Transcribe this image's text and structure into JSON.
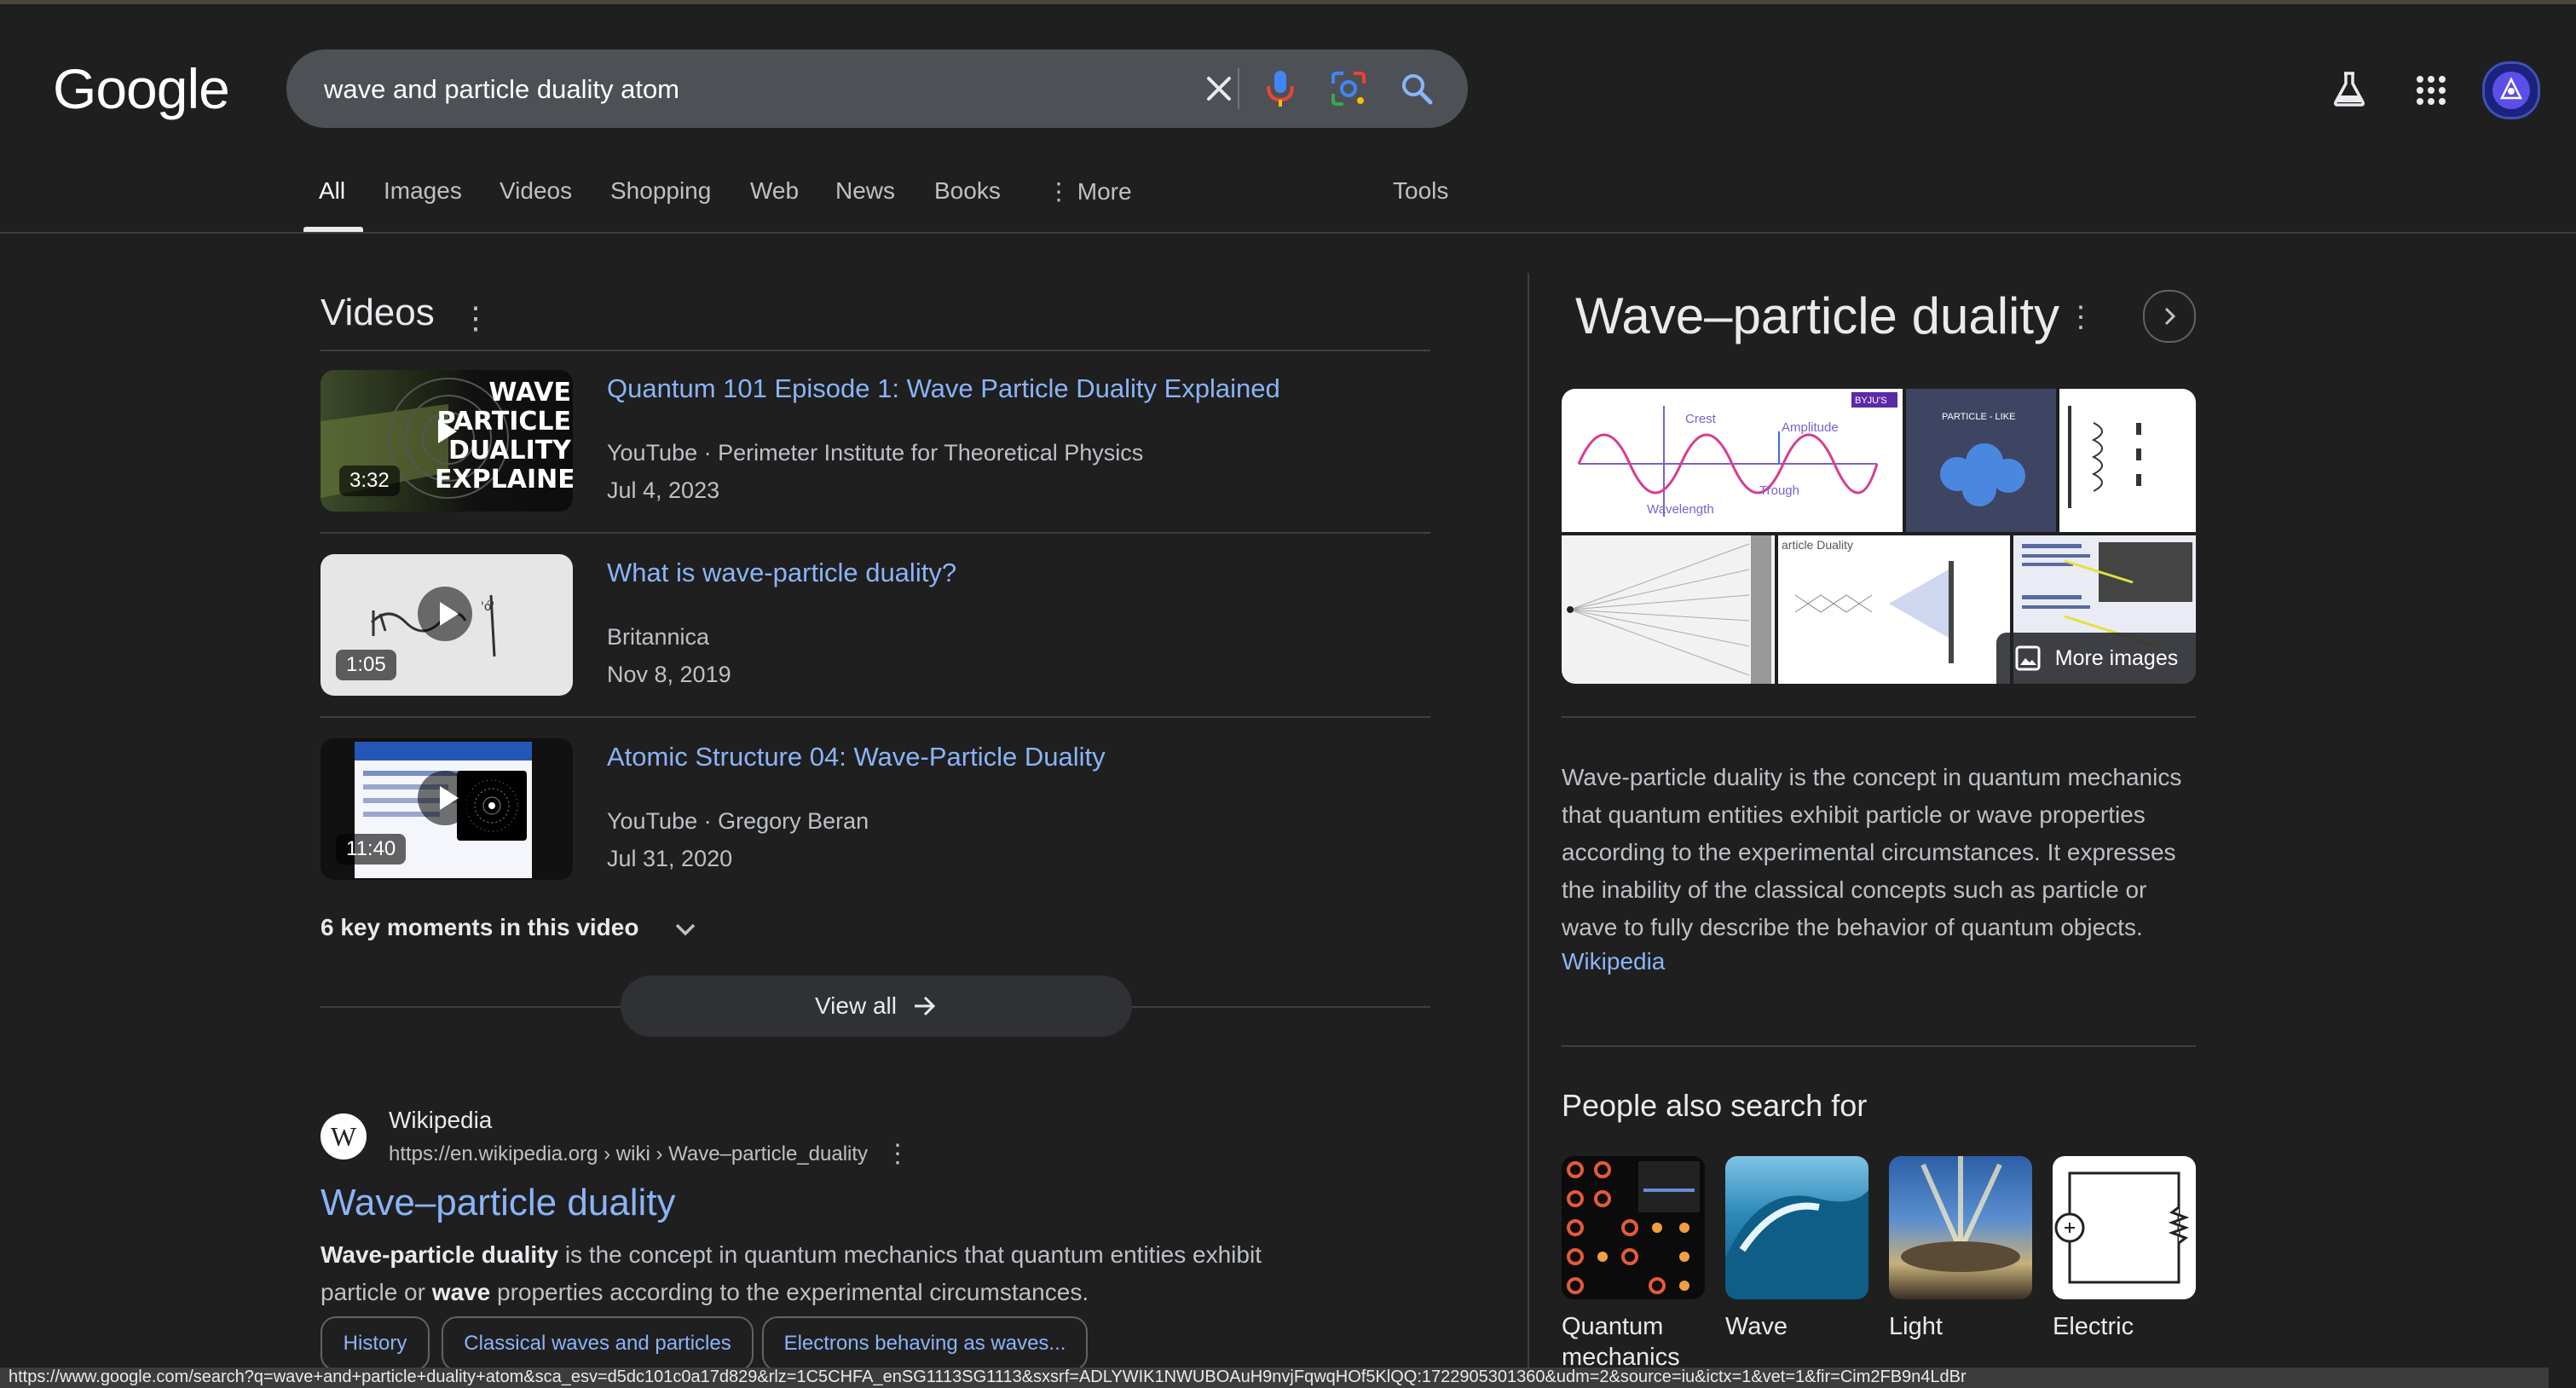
{
  "header": {
    "logo": "Google",
    "search_value": "wave and particle duality atom",
    "icons": [
      "clear-icon",
      "microphone-icon",
      "lens-icon",
      "search-icon",
      "labs-flask-icon",
      "apps-grid-icon",
      "avatar"
    ]
  },
  "tabs": [
    "All",
    "Images",
    "Videos",
    "Shopping",
    "Web",
    "News",
    "Books",
    "More",
    "Tools"
  ],
  "videos": {
    "title": "Videos",
    "items": [
      {
        "title": "Quantum 101 Episode 1: Wave Particle Duality Explained",
        "source": "YouTube · Perimeter Institute for Theoretical Physics",
        "date": "Jul 4, 2023",
        "duration": "3:32",
        "thumb_text": [
          "WAVE",
          "PARTICLE",
          "DUALITY",
          "EXPLAINED"
        ]
      },
      {
        "title": "What is wave-particle duality?",
        "source": "Britannica",
        "date": "Nov 8, 2019",
        "duration": "1:05"
      },
      {
        "title": "Atomic Structure 04: Wave-Particle Duality",
        "source": "YouTube · Gregory Beran",
        "date": "Jul 31, 2020",
        "duration": "11:40"
      }
    ],
    "key_moments": "6 key moments in this video",
    "view_all": "View all"
  },
  "result": {
    "site_name": "Wikipedia",
    "favicon_letter": "W",
    "url": "https://en.wikipedia.org › wiki › Wave–particle_duality",
    "title": "Wave–particle duality",
    "snippet_b1": "Wave-particle duality",
    "snippet_t1": " is the concept in quantum mechanics that quantum entities exhibit",
    "snippet_t2": "particle or ",
    "snippet_b2": "wave",
    "snippet_t3": " properties according to the experimental circumstances.",
    "chips": [
      "History",
      "Classical waves and particles",
      "Electrons behaving as waves..."
    ]
  },
  "knowledge_panel": {
    "title": "Wave–particle duality",
    "more_images": "More images",
    "img_labels": {
      "crest": "Crest",
      "amplitude": "Amplitude",
      "trough": "Trough",
      "wavelength": "Wavelength",
      "particle_like": "PARTICLE - LIKE",
      "byjus": "BYJU'S",
      "particle_duality": "article Duality"
    },
    "description": "Wave-particle duality is the concept in quantum mechanics that quantum entities exhibit particle or wave properties according to the experimental circumstances. It expresses the inability of the classical concepts such as particle or wave to fully describe the behavior of quantum objects.",
    "source_link": "Wikipedia",
    "people_also_search": {
      "title": "People also search for",
      "items": [
        {
          "label1": "Quantum",
          "label2": "mechanics"
        },
        {
          "label1": "Wave",
          "label2": ""
        },
        {
          "label1": "Light",
          "label2": ""
        },
        {
          "label1": "Electric",
          "label2": ""
        }
      ]
    }
  },
  "status_url": "https://www.google.com/search?q=wave+and+particle+duality+atom&sca_esv=d5dc101c0a17d829&rlz=1C5CHFA_enSG1113SG1113&sxsrf=ADLYWIK1NWUBOAuH9nvjFqwqHOf5KlQQ:1722905301360&udm=2&source=iu&ictx=1&vet=1&fir=Cim2FB9n4LdBr"
}
